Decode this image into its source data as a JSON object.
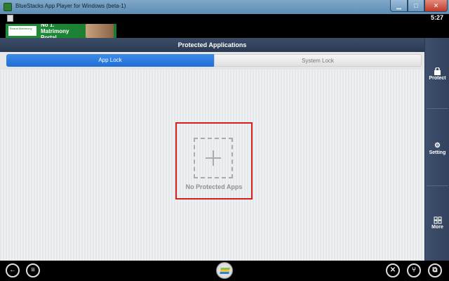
{
  "window": {
    "title": "BlueStacks App Player for Windows (beta-1)",
    "minimize_glyph": "▁",
    "maximize_glyph": "□",
    "close_glyph": "✕"
  },
  "status_bar": {
    "time": "5:27"
  },
  "ad": {
    "logo_text": "Bharat Matrimony",
    "headline": "No 1. Matrimony Portal"
  },
  "app": {
    "header_title": "Protected Applications",
    "tabs": [
      {
        "label": "App Lock",
        "selected": true
      },
      {
        "label": "System Lock",
        "selected": false
      }
    ],
    "empty_state": {
      "icon": "plus-icon",
      "label": "No Protected Apps"
    },
    "highlight_color": "#d62020"
  },
  "sidebar": {
    "items": [
      {
        "label": "Protect",
        "icon": "lock-icon"
      },
      {
        "label": "Setting",
        "icon": "gear-icon"
      },
      {
        "label": "More",
        "icon": "grid-icon"
      }
    ]
  },
  "bottom_nav": {
    "back_glyph": "←",
    "menu_glyph": "≡",
    "tools_glyph": "✕",
    "share_glyph": "⑂",
    "window_glyph": "⧉"
  },
  "colors": {
    "tab_active": "#1f6fd6",
    "header_bg": "#2b3a52",
    "sidebar_bg": "#3e4f6c"
  }
}
